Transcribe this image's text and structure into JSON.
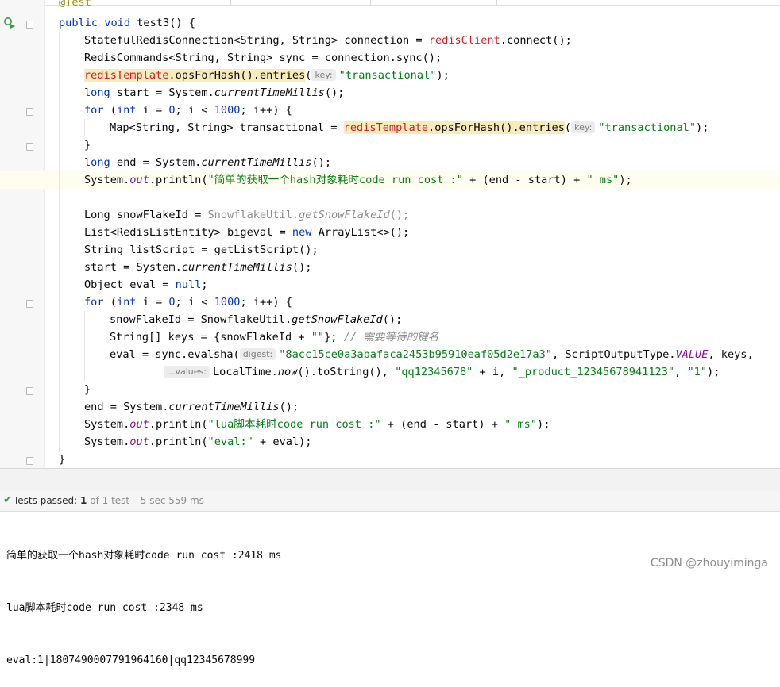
{
  "editor": {
    "lines": {
      "l0": {
        "a": "@Test"
      },
      "l1": {
        "a": "public",
        "b": " ",
        "c": "void",
        "d": " test3() {"
      },
      "l2": {
        "a": "StatefulRedisConnection<String, String> connection = ",
        "b": "redisClient",
        "c": ".connect();"
      },
      "l3": {
        "a": "RedisCommands<String, String> sync = connection.sync();"
      },
      "l4": {
        "a": "redisTemplate",
        "b": ".opsForHash().entries",
        "c": "(",
        "hint": "key:",
        "d": "\"transactional\"",
        "e": ");"
      },
      "l5": {
        "a": "long",
        "b": " start = System.",
        "c": "currentTimeMillis",
        "d": "();"
      },
      "l6": {
        "a": "for",
        "b": " (",
        "c": "int",
        "d": " i = ",
        "e": "0",
        "f": "; i < ",
        "g": "1000",
        "h": "; i++) {"
      },
      "l7": {
        "a": "Map<String, String> transactional = ",
        "b": "redisTemplate",
        "c": ".opsForHash().entries",
        "d": "(",
        "hint": "key:",
        "e": "\"transactional\"",
        "f": ");"
      },
      "l8": {
        "a": "}"
      },
      "l9": {
        "a": "long",
        "b": " end = System.",
        "c": "currentTimeMillis",
        "d": "();"
      },
      "l10": {
        "a": "System.",
        "b": "out",
        "c": ".println(",
        "d": "\"简单的获取一个hash对象耗时code run cost :\"",
        "e": " + (end - start) + ",
        "f": "\" ms\"",
        "g": ");"
      },
      "l12": {
        "a": "Long snowFlakeId = ",
        "b": "SnowflakeUtil.",
        "c": "getSnowFlakeId",
        "d": "();"
      },
      "l13": {
        "a": "List<RedisListEntity> bigeval = ",
        "b": "new",
        "c": " ArrayList<>();"
      },
      "l14": {
        "a": "String listScript = getListScript();"
      },
      "l15": {
        "a": "start = System.",
        "b": "currentTimeMillis",
        "c": "();"
      },
      "l16": {
        "a": "Object eval = ",
        "b": "null",
        "c": ";"
      },
      "l17": {
        "a": "for",
        "b": " (",
        "c": "int",
        "d": " i = ",
        "e": "0",
        "f": "; i < ",
        "g": "1000",
        "h": "; i++) {"
      },
      "l18": {
        "a": "snowFlakeId = SnowflakeUtil.",
        "b": "getSnowFlakeId",
        "c": "();"
      },
      "l19": {
        "a": "String[] keys = {snowFlakeId + ",
        "b": "\"\"",
        "c": "}; ",
        "d": "// 需要等待的键名"
      },
      "l20": {
        "a": "eval = sync.evalsha(",
        "hint": "digest:",
        "b": "\"8acc15ce0a3abafaca2453b95910eaf05d2e17a3\"",
        "c": ", ScriptOutputType.",
        "d": "VALUE",
        "e": ", keys,"
      },
      "l21": {
        "hint": "...values:",
        "a": "LocalTime.",
        "b": "now",
        "c": "().toString(), ",
        "d": "\"qq12345678\"",
        "e": " + i, ",
        "f": "\"_product_12345678941123\"",
        "g": ", ",
        "h": "\"1\"",
        "i": ");"
      },
      "l22": {
        "a": "}"
      },
      "l23": {
        "a": "end = System.",
        "b": "currentTimeMillis",
        "c": "();"
      },
      "l24": {
        "a": "System.",
        "b": "out",
        "c": ".println(",
        "d": "\"lua脚本耗时code run cost :\"",
        "e": " + (end - start) + ",
        "f": "\" ms\"",
        "g": ");"
      },
      "l25": {
        "a": "System.",
        "b": "out",
        "c": ".println(",
        "d": "\"eval:\"",
        "e": " + eval);"
      },
      "l26": {
        "a": "}"
      }
    }
  },
  "test_status": {
    "label": "Tests passed:",
    "passed": "1",
    "detail": "of 1 test – 5 sec 559 ms"
  },
  "console": {
    "lines": [
      "简单的获取一个hash对象耗时code run cost :2418 ms",
      "lua脚本耗时code run cost :2348 ms",
      "eval:1|1807490007791964160|qq12345678999"
    ]
  },
  "watermark": "CSDN @zhouyiminga",
  "colors": {
    "keyword": "#0033b3",
    "string": "#067d17",
    "field": "#871094",
    "annotation": "#9e880d",
    "success": "#3e9a47"
  }
}
